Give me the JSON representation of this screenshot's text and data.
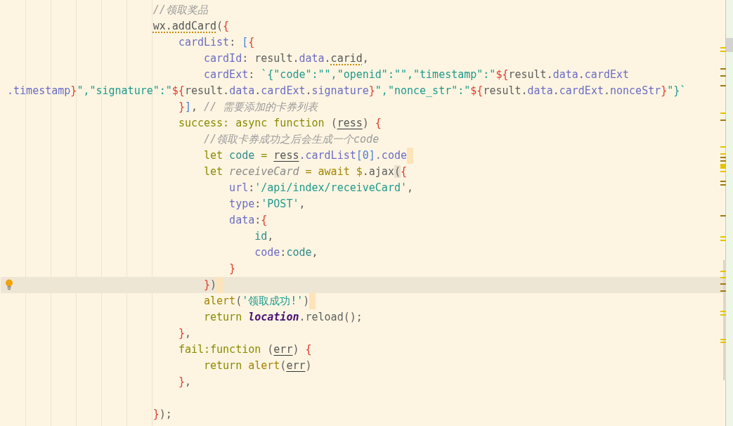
{
  "editor": {
    "lines": [
      {
        "tokens": [
          {
            "text": "                        //领取奖品",
            "kind": "comment"
          }
        ]
      },
      {
        "tokens": [
          {
            "text": "                        wx.addCard",
            "kind": "warned"
          },
          {
            "text": "(",
            "kind": "plain"
          },
          {
            "text": "{",
            "kind": "brace"
          }
        ]
      },
      {
        "tokens": [
          {
            "text": "                            cardList",
            "kind": "property"
          },
          {
            "text": ": ",
            "kind": "plain"
          },
          {
            "text": "[",
            "kind": "bracket"
          },
          {
            "text": "{",
            "kind": "brace"
          }
        ]
      },
      {
        "tokens": [
          {
            "text": "                                cardId",
            "kind": "property"
          },
          {
            "text": ": result.",
            "kind": "plain"
          },
          {
            "text": "data",
            "kind": "property"
          },
          {
            "text": ".",
            "kind": "plain"
          },
          {
            "text": "carid",
            "kind": "warned"
          },
          {
            "text": ",",
            "kind": "plain"
          }
        ]
      },
      {
        "tokens": [
          {
            "text": "                                cardExt",
            "kind": "property"
          },
          {
            "text": ": ",
            "kind": "plain"
          },
          {
            "text": "`{\"code\":\"\",\"openid\":\"\",\"timestamp\":\"",
            "kind": "string"
          },
          {
            "text": "${",
            "kind": "brace"
          },
          {
            "text": "result.",
            "kind": "plain"
          },
          {
            "text": "data",
            "kind": "property"
          },
          {
            "text": ".",
            "kind": "plain"
          },
          {
            "text": "cardExt",
            "kind": "property"
          }
        ]
      },
      {
        "tokens": [
          {
            "text": " .timestamp",
            "kind": "property"
          },
          {
            "text": "}",
            "kind": "brace"
          },
          {
            "text": "\",\"signature\":\"",
            "kind": "string"
          },
          {
            "text": "${",
            "kind": "brace"
          },
          {
            "text": "result.",
            "kind": "plain"
          },
          {
            "text": "data",
            "kind": "property"
          },
          {
            "text": ".",
            "kind": "plain"
          },
          {
            "text": "cardExt",
            "kind": "property"
          },
          {
            "text": ".",
            "kind": "plain"
          },
          {
            "text": "signature",
            "kind": "property"
          },
          {
            "text": "}",
            "kind": "brace"
          },
          {
            "text": "\",\"nonce_str\":\"",
            "kind": "string"
          },
          {
            "text": "${",
            "kind": "brace"
          },
          {
            "text": "result.",
            "kind": "plain"
          },
          {
            "text": "data",
            "kind": "property"
          },
          {
            "text": ".",
            "kind": "plain"
          },
          {
            "text": "cardExt",
            "kind": "property"
          },
          {
            "text": ".",
            "kind": "plain"
          },
          {
            "text": "nonceStr",
            "kind": "property"
          },
          {
            "text": "}",
            "kind": "brace"
          },
          {
            "text": "\"}`",
            "kind": "string"
          }
        ]
      },
      {
        "tokens": [
          {
            "text": "                            }",
            "kind": "brace"
          },
          {
            "text": "]",
            "kind": "bracket"
          },
          {
            "text": ", ",
            "kind": "plain"
          },
          {
            "text": "// 需要添加的卡券列表",
            "kind": "comment"
          }
        ]
      },
      {
        "tokens": [
          {
            "text": "                            success: async function ",
            "kind": "keyword"
          },
          {
            "text": "(",
            "kind": "plain"
          },
          {
            "text": "ress",
            "kind": "param"
          },
          {
            "text": ") ",
            "kind": "plain"
          },
          {
            "text": "{",
            "kind": "brace"
          }
        ]
      },
      {
        "tokens": [
          {
            "text": "                                //领取卡券成功之后会生成一个code",
            "kind": "comment"
          }
        ]
      },
      {
        "end_mark": true,
        "tokens": [
          {
            "text": "                                let ",
            "kind": "keyword"
          },
          {
            "text": "code",
            "kind": "variable"
          },
          {
            "text": " = ",
            "kind": "keyword"
          },
          {
            "text": "ress",
            "kind": "param"
          },
          {
            "text": ".cardList",
            "kind": "property"
          },
          {
            "text": "[0]",
            "kind": "bracket"
          },
          {
            "text": ".code",
            "kind": "property"
          }
        ]
      },
      {
        "tokens": [
          {
            "text": "                                let ",
            "kind": "keyword"
          },
          {
            "text": "receiveCard",
            "kind": "italic"
          },
          {
            "text": " = await $",
            "kind": "call"
          },
          {
            "text": ".ajax",
            "kind": "plain"
          },
          {
            "text": "(",
            "kind": "matched"
          },
          {
            "text": "{",
            "kind": "brace"
          }
        ]
      },
      {
        "tokens": [
          {
            "text": "                                    url",
            "kind": "property"
          },
          {
            "text": ":",
            "kind": "plain"
          },
          {
            "text": "'/api/index/receiveCard'",
            "kind": "string"
          },
          {
            "text": ",",
            "kind": "plain"
          }
        ]
      },
      {
        "tokens": [
          {
            "text": "                                    type",
            "kind": "property"
          },
          {
            "text": ":",
            "kind": "plain"
          },
          {
            "text": "'POST'",
            "kind": "string"
          },
          {
            "text": ",",
            "kind": "plain"
          }
        ]
      },
      {
        "tokens": [
          {
            "text": "                                    data",
            "kind": "property"
          },
          {
            "text": ":",
            "kind": "plain"
          },
          {
            "text": "{",
            "kind": "brace"
          }
        ]
      },
      {
        "tokens": [
          {
            "text": "                                        id",
            "kind": "variable"
          },
          {
            "text": ",",
            "kind": "plain"
          }
        ]
      },
      {
        "tokens": [
          {
            "text": "                                        code",
            "kind": "property"
          },
          {
            "text": ":",
            "kind": "plain"
          },
          {
            "text": "code",
            "kind": "variable"
          },
          {
            "text": ",",
            "kind": "plain"
          }
        ]
      },
      {
        "tokens": [
          {
            "text": "                                    }",
            "kind": "brace"
          }
        ]
      },
      {
        "current": true,
        "end_mark": true,
        "tokens": [
          {
            "text": "                                }",
            "kind": "brace"
          },
          {
            "text": ")",
            "kind": "plain"
          }
        ]
      },
      {
        "end_mark": true,
        "tokens": [
          {
            "text": "                                alert",
            "kind": "call"
          },
          {
            "text": "(",
            "kind": "plain"
          },
          {
            "text": "'领取成功!'",
            "kind": "string"
          },
          {
            "text": ")",
            "kind": "plain"
          }
        ]
      },
      {
        "tokens": [
          {
            "text": "                                return ",
            "kind": "keyword"
          },
          {
            "text": "location",
            "kind": "global"
          },
          {
            "text": ".reload();",
            "kind": "plain"
          }
        ]
      },
      {
        "tokens": [
          {
            "text": "                            }",
            "kind": "brace"
          },
          {
            "text": ",",
            "kind": "plain"
          }
        ]
      },
      {
        "tokens": [
          {
            "text": "                            fail:function ",
            "kind": "keyword"
          },
          {
            "text": "(",
            "kind": "plain"
          },
          {
            "text": "err",
            "kind": "param"
          },
          {
            "text": ") ",
            "kind": "plain"
          },
          {
            "text": "{",
            "kind": "brace"
          }
        ]
      },
      {
        "tokens": [
          {
            "text": "                                return ",
            "kind": "keyword"
          },
          {
            "text": "alert",
            "kind": "call"
          },
          {
            "text": "(",
            "kind": "plain"
          },
          {
            "text": "err",
            "kind": "param"
          },
          {
            "text": ")",
            "kind": "plain"
          }
        ]
      },
      {
        "tokens": [
          {
            "text": "                            }",
            "kind": "brace"
          },
          {
            "text": ",",
            "kind": "plain"
          }
        ]
      },
      {
        "gap_before": true,
        "tokens": [
          {
            "text": "                        }",
            "kind": "brace"
          },
          {
            "text": ");",
            "kind": "plain"
          }
        ]
      }
    ]
  }
}
